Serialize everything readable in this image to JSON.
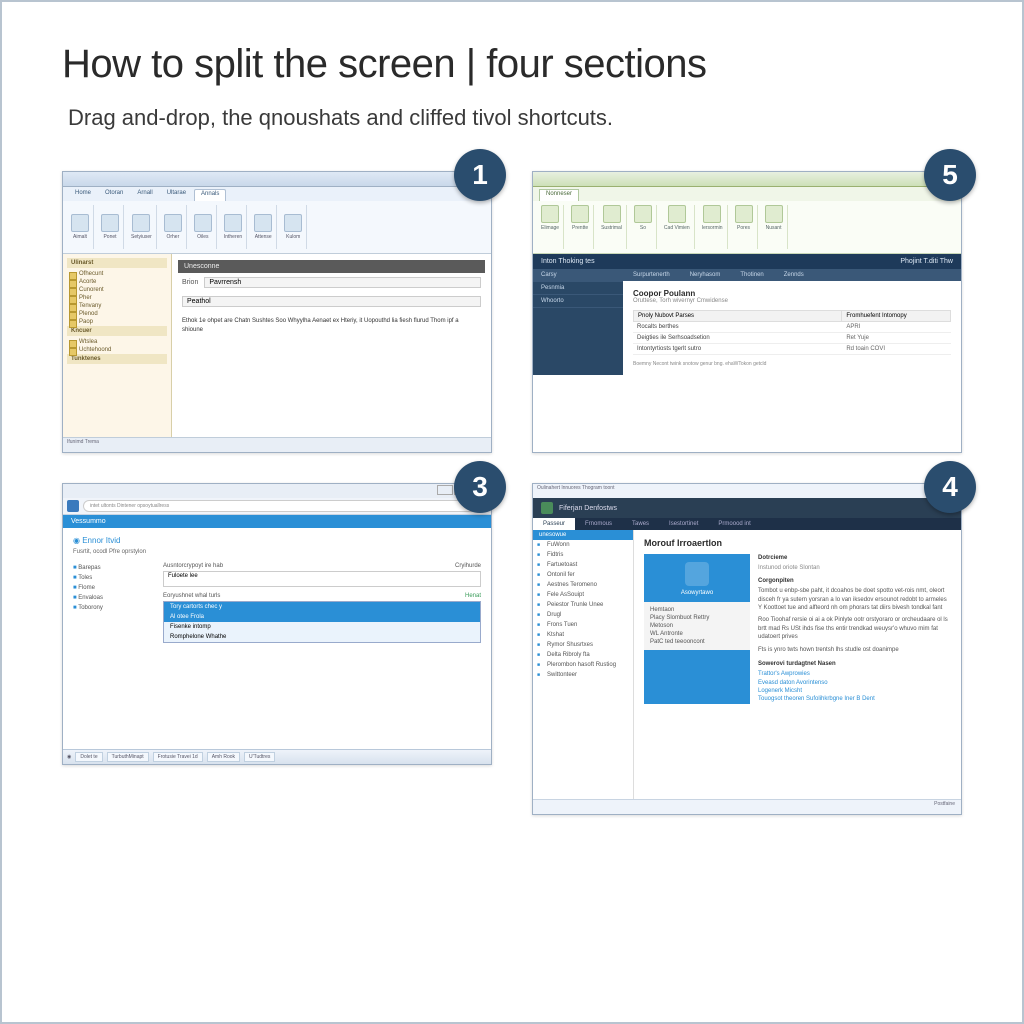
{
  "title": "How to split the screen | four sections",
  "subtitle": "Drag and-drop, the qnoushats and cliffed tivol shortcuts.",
  "badges": {
    "b1": "1",
    "b2": "5",
    "b3": "3",
    "b4": "4"
  },
  "panel1": {
    "tabs": [
      "Home",
      "Otoran",
      "Arnall",
      "Ultarae",
      "Annals"
    ],
    "ribbon_labels": [
      "Aimalt",
      "Ponet",
      "Setyiuser",
      "Orher",
      "Oiles",
      "Intheren",
      "Attense",
      "Kulom"
    ],
    "side_header": "Ulinarst",
    "side_items": [
      "Ofhecunt",
      "Acorte",
      "Cunorent",
      "Pher",
      "Tenvany",
      "Plenod",
      "Paop"
    ],
    "side_sec2": "Kncuer",
    "side_items2": [
      "Wtslea",
      "Uchtehoond"
    ],
    "side_sec3": "Tunktenes",
    "dark_header": "Unesconne",
    "field_label": "Brion",
    "field_value": "Pavrrensh",
    "secondary": "Peathol",
    "bodytext": "Ethok 1e ohpet are Chatn Sushtes Soo Whyylha Aenaet ex Hteriy, it Uopouthd lia fiesh flurud Thom ipf a shioune",
    "status": "Ifunimd Trema"
  },
  "panel5": {
    "tabs": [
      "Nonneser"
    ],
    "ribbon_labels": [
      "Elimage",
      "Prentte",
      "Sustrimal",
      "So",
      "Cad Vimien",
      "Iersormin",
      "Pores",
      "Nusant"
    ],
    "navy_title_left": "Inton Thoking tes",
    "navy_title_right": "Phojint T.diti Thw",
    "side_items": [
      "Carsy",
      "Pesnmia",
      "Whoorto"
    ],
    "tabbar": [
      "Surpurtenerth",
      "Neryhasom",
      "Thotinen",
      "Zennds"
    ],
    "doc_title": "Coopor Poulann",
    "doc_sub": "Oruttese, Torh wivernyr Cmwidense",
    "th1": "Pnoly Nubovt Parses",
    "th2": "Fromhuefent Intomopy",
    "rows": [
      [
        "Rocalts berthes",
        "APRI"
      ],
      [
        "Deigties ile Serhsoadsetion",
        "Ret Yuje"
      ],
      [
        "Intontyrtiosts tgerlt sutro",
        "Rd toain COVI"
      ]
    ],
    "foot": "Boemny Necont twink snotow genur bng.   ehaWTokon getcld"
  },
  "panel3": {
    "url": "intet ultonts Dintener opsoytuallress",
    "appbar": "Vessummo",
    "account": "Ennor Itvid",
    "sub": "Fusrtit, ocodl Pfre oprstylon",
    "list": [
      "Barepas",
      "Toles",
      "Flome",
      "Envaloas",
      "Toborony"
    ],
    "form_label1": "Ausntorcrypoyt ire hab",
    "form_right": "Cryihurde",
    "form_input": "Fuloete lee",
    "form_label2": "Eoryushnet whal turls",
    "form_badge": "Henat",
    "ctx": [
      "Tory cartorts chec y",
      "Al otee Frola",
      "Fisenke intomp",
      "Romphelone Whathe"
    ],
    "taskbar": [
      "Dolet te",
      "TurbuthMinapt",
      "Frotusie Travei 1d",
      "Amh Rook",
      "U'Tudtres"
    ]
  },
  "panel4": {
    "titlebar": "Oulinahert lnnuores Thogram toont",
    "header": "Fiferjan Denfostws",
    "navtabs": [
      "Passeur",
      "Frnomous",
      "Tawes",
      "Isestortinet",
      "Prmoood int"
    ],
    "side_header": "unesowue",
    "side_items": [
      "FuWonn",
      "Fidtris",
      "Fartuetoast",
      "Ontonil fer",
      "Aestnes Teromeno",
      "Fele AsSouipt",
      "Peiestor Trunle Unee",
      "Drugl",
      "Frons Tuen",
      "Ktshat",
      "Rymor Shusrtxes",
      "Delta Ribroly fta",
      "Plerombon hasoft Rustiog",
      "Swittonteer"
    ],
    "main_title": "Morouf Irroaertlon",
    "card_title": "Asowyrtawo",
    "card_list": [
      "Hemtaon",
      "Placy Slombuot Rettry",
      "Metoson",
      "WL Antronte",
      "PatC ted teeooncont"
    ],
    "right_h1": "Dotrcieme",
    "right_breadcrumb": "Instunod oriote Slontan",
    "right_h2": "Corgonpiten",
    "right_body1": "Tombot u enbp-sbe paht, it dcoahos be doet spotto vet-rois nmt, oleort disceh fr ya sutern yorsran a lo van iksedov ersounot redobt to armeles Y Koottoet tue and alfteord nh om phorars tat diirs bivesh tondkal fant",
    "right_body2": "Roo Tioohaf rersie oi ai a ok Pinlyte ootr orstyoraro or orcheudaare ol ls brtt mad Rs USt ihds fise ths entir trendkad weuysr'o whuvo mim fat udatoert prives",
    "right_body3": "Fts is ynro twts hown trentsh lhs studle ost doanimpe",
    "right_h3": "Sowerovi turdagtnet Nasen",
    "links": [
      "Trattor's Awprowies",
      "Eveasd daton Avorintenso",
      "Logenerk Micsht",
      "Touogsot theoren Sufolihkrbgne Iner B Dent"
    ],
    "status": "Postfaine"
  }
}
